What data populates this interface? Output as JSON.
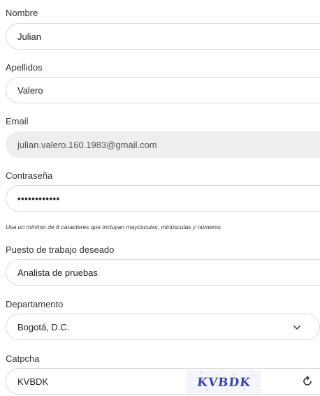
{
  "form": {
    "nombre": {
      "label": "Nombre",
      "value": "Julian"
    },
    "apellidos": {
      "label": "Apellidos",
      "value": "Valero"
    },
    "email": {
      "label": "Email",
      "value": "julian.valero.160.1983@gmail.com"
    },
    "password": {
      "label": "Contraseña",
      "value": "••••••••••••",
      "hint": "Usa un mínimo de 8 caracteres que incluyan mayúsculas, minúsculas y números"
    },
    "puesto": {
      "label": "Puesto de trabajo deseado",
      "value": "Analista de pruebas"
    },
    "departamento": {
      "label": "Departamento",
      "value": "Bogotá, D.C."
    },
    "captcha": {
      "label": "Catpcha",
      "value": "KVBDK",
      "image_text": "KVBDK"
    }
  },
  "icons": {
    "dropdown": "chevron-down-icon",
    "refresh": "refresh-icon"
  }
}
